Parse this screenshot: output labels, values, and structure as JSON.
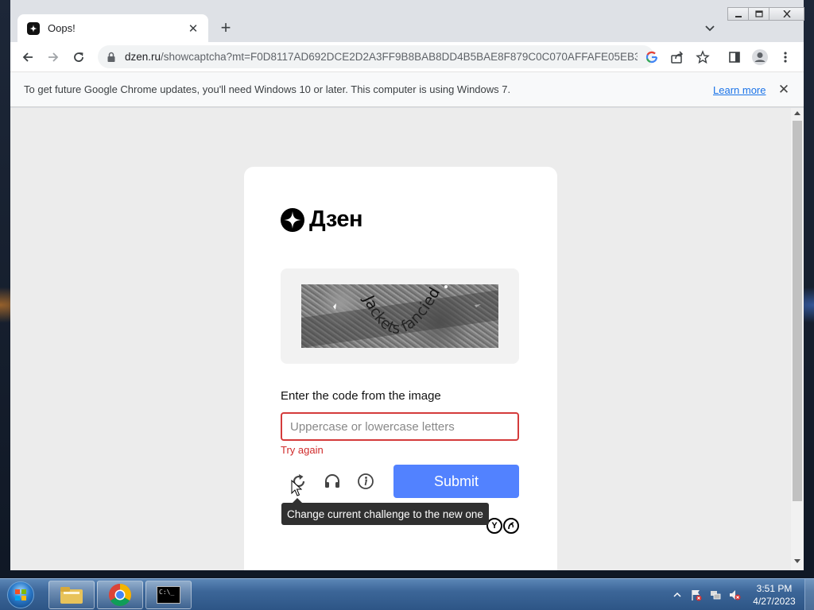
{
  "browser": {
    "tab": {
      "title": "Oops!"
    },
    "address_bar": {
      "domain": "dzen.ru",
      "path": "/showcaptcha?mt=F0D8117AD692DCE2D2A3FF9B8BAB8DD4B5BAE8F879C0C070AFFAFE05EB3..."
    },
    "infobar": {
      "message": "To get future Google Chrome updates, you'll need Windows 10 or later. This computer is using Windows 7.",
      "link": "Learn more"
    }
  },
  "page": {
    "brand": "Дзен",
    "captcha": {
      "image_text": "Jackets fancied"
    },
    "instruction": "Enter the code from the image",
    "input": {
      "placeholder": "Uppercase or lowercase letters",
      "value": ""
    },
    "error": "Try again",
    "submit_label": "Submit",
    "tooltip": "Change current challenge to the new one",
    "icons": [
      "refresh-icon",
      "headphones-icon",
      "info-icon"
    ]
  },
  "taskbar": {
    "clock": {
      "time": "3:51 PM",
      "date": "4/27/2023"
    },
    "apps": [
      "file-explorer",
      "google-chrome",
      "command-prompt"
    ],
    "cmd_label": "C:\\_"
  },
  "colors": {
    "submit": "#5282ff",
    "error": "#d02b2b",
    "link": "#1a73e8"
  }
}
